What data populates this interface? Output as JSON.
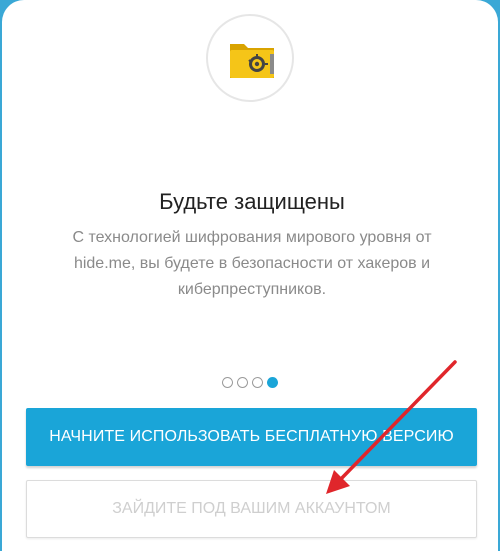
{
  "onboarding": {
    "title": "Будьте защищены",
    "description": "С технологией шифрования мирового уровня от hide.me, вы будете в безопасности от хакеров и киберпреступников.",
    "pages_total": 4,
    "current_page": 4
  },
  "buttons": {
    "primary_label": "НАЧНИТЕ ИСПОЛЬЗОВАТЬ БЕСПЛАТНУЮ ВЕРСИЮ",
    "secondary_label": "ЗАЙДИТЕ ПОД ВАШИМ АККАУНТОМ"
  },
  "icons": {
    "logo": "vault-safe-icon",
    "annotation": "red-arrow-icon"
  },
  "colors": {
    "accent": "#1aa5d8",
    "logo_yellow": "#f5c518",
    "arrow_red": "#e0262b"
  }
}
